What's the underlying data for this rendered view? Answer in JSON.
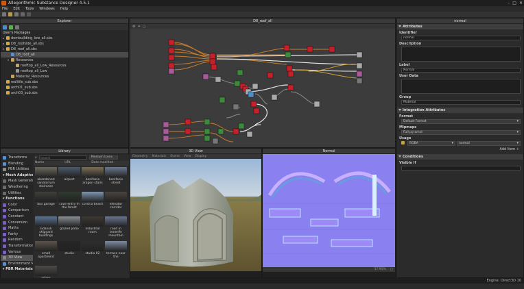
{
  "app": {
    "title": "Allegorithmic Substance Designer 4.5.1",
    "engine": "Engine: Direct3D 10"
  },
  "menu": [
    "File",
    "Edit",
    "Tools",
    "Windows",
    "Help"
  ],
  "explorer": {
    "title": "Explorer",
    "section": "User's Packages",
    "rows": [
      {
        "label": "dombuilding_low_all.sbs",
        "indent": 0,
        "icon": "package",
        "expanded": false
      },
      {
        "label": "D8_roofside_all.sbs",
        "indent": 0,
        "icon": "package",
        "expanded": false
      },
      {
        "label": "D8_roof_all.sbs",
        "indent": 0,
        "icon": "package",
        "expanded": true
      },
      {
        "label": "D8_roof_all",
        "indent": 1,
        "icon": "graph",
        "selected": true
      },
      {
        "label": "Resources",
        "indent": 1,
        "icon": "folder",
        "expanded": true
      },
      {
        "label": "rooftop_all_Low_Resources",
        "indent": 2,
        "icon": "folder"
      },
      {
        "label": "rooftop_all_Low",
        "indent": 2,
        "icon": "mesh"
      },
      {
        "label": "Material_Resources",
        "indent": 1,
        "icon": "folder"
      },
      {
        "label": "walltile_sub.sbs",
        "indent": 0,
        "icon": "package"
      },
      {
        "label": "arch01_sub.sbs",
        "indent": 0,
        "icon": "package"
      },
      {
        "label": "arch03_sub.sbs",
        "indent": 0,
        "icon": "package"
      }
    ]
  },
  "graph": {
    "title": "D8_roof_all"
  },
  "library": {
    "title": "Library",
    "search_placeholder": "Search",
    "size_label": "Medium Icons",
    "columns": [
      "Name",
      "URL",
      "Date modified"
    ],
    "categories": [
      {
        "label": "Transforms",
        "cat": false,
        "color": "#5a8fd0"
      },
      {
        "label": "Blending",
        "cat": false,
        "color": "#5a8fd0"
      },
      {
        "label": "PBR Utilities",
        "cat": false,
        "color": "#8a8a8a"
      },
      {
        "label": "Mesh Adaptive",
        "cat": true
      },
      {
        "label": "Mask Generators",
        "cat": false,
        "color": "#6a6a6a"
      },
      {
        "label": "Weathering",
        "cat": false,
        "color": "#6a6a6a"
      },
      {
        "label": "Utilities",
        "cat": false,
        "color": "#6a6a6a"
      },
      {
        "label": "Functions",
        "cat": true
      },
      {
        "label": "Color",
        "cat": false,
        "color": "#7a5fc0"
      },
      {
        "label": "Comparison",
        "cat": false,
        "color": "#7a5fc0"
      },
      {
        "label": "Constant",
        "cat": false,
        "color": "#7a5fc0"
      },
      {
        "label": "Conversion",
        "cat": false,
        "color": "#7a5fc0"
      },
      {
        "label": "Maths",
        "cat": false,
        "color": "#7a5fc0"
      },
      {
        "label": "Parity",
        "cat": false,
        "color": "#7a5fc0"
      },
      {
        "label": "Random",
        "cat": false,
        "color": "#7a5fc0"
      },
      {
        "label": "Transformation",
        "cat": false,
        "color": "#7a5fc0"
      },
      {
        "label": "Various",
        "cat": false,
        "color": "#7a5fc0"
      },
      {
        "label": "3D View",
        "cat": false,
        "color": "#888",
        "selected": true
      },
      {
        "label": "Environment Maps",
        "cat": false,
        "color": "#5a8fd0"
      },
      {
        "label": "PBR Materials",
        "cat": true
      }
    ],
    "items": [
      {
        "label": "abandoned sanatorium staircase",
        "color": "#6d6a5e"
      },
      {
        "label": "airport",
        "color": "#4c5a6b"
      },
      {
        "label": "bonifacio aragon stairs",
        "color": "#7b6f57"
      },
      {
        "label": "bonifacio street",
        "color": "#6b7a8e"
      },
      {
        "label": "bus garage",
        "color": "#3e3e3a"
      },
      {
        "label": "cave entry in the forest",
        "color": "#2f3a2e"
      },
      {
        "label": "corsica beach",
        "color": "#7f95b0"
      },
      {
        "label": "elevator corridor",
        "color": "#4a4440"
      },
      {
        "label": "Gdansk shipyard buildings",
        "color": "#5d7593"
      },
      {
        "label": "glazed patio",
        "color": "#8a8f92"
      },
      {
        "label": "industrial room",
        "color": "#3c3833"
      },
      {
        "label": "road in tenerife mountain",
        "color": "#6a7690"
      },
      {
        "label": "small apartment",
        "color": "#5b534a"
      },
      {
        "label": "studio",
        "color": "#262626"
      },
      {
        "label": "studio 02",
        "color": "#2e2e2e"
      },
      {
        "label": "terrace near the",
        "color": "#7d8aa0"
      },
      {
        "label": "urban exploring",
        "color": "#4d4b47"
      }
    ]
  },
  "view3d": {
    "title": "3D View",
    "menus": [
      "Geometry",
      "Materials",
      "Scene",
      "View",
      "Display"
    ]
  },
  "view2d": {
    "title": "Normal",
    "zoom": "17.91%",
    "size": "1k"
  },
  "attributes": {
    "title": "Attributes",
    "panel_title": "normal",
    "identifier_label": "Identifier",
    "identifier": "normal",
    "description_label": "Description",
    "label_label": "Label",
    "label": "Normal",
    "user_data_label": "User Data",
    "group_label": "Group",
    "group": "Material",
    "integration_title": "Integration Attributes",
    "format_label": "Format",
    "format": "Default Format",
    "mipmaps_label": "Mipmaps",
    "mipmaps": "Full pyramid",
    "usage_label": "Usage",
    "usage_type": "RGBA",
    "usage_value": "normal",
    "add_item": "Add Item",
    "conditions_title": "Conditions",
    "visible_if_label": "Visible If"
  }
}
